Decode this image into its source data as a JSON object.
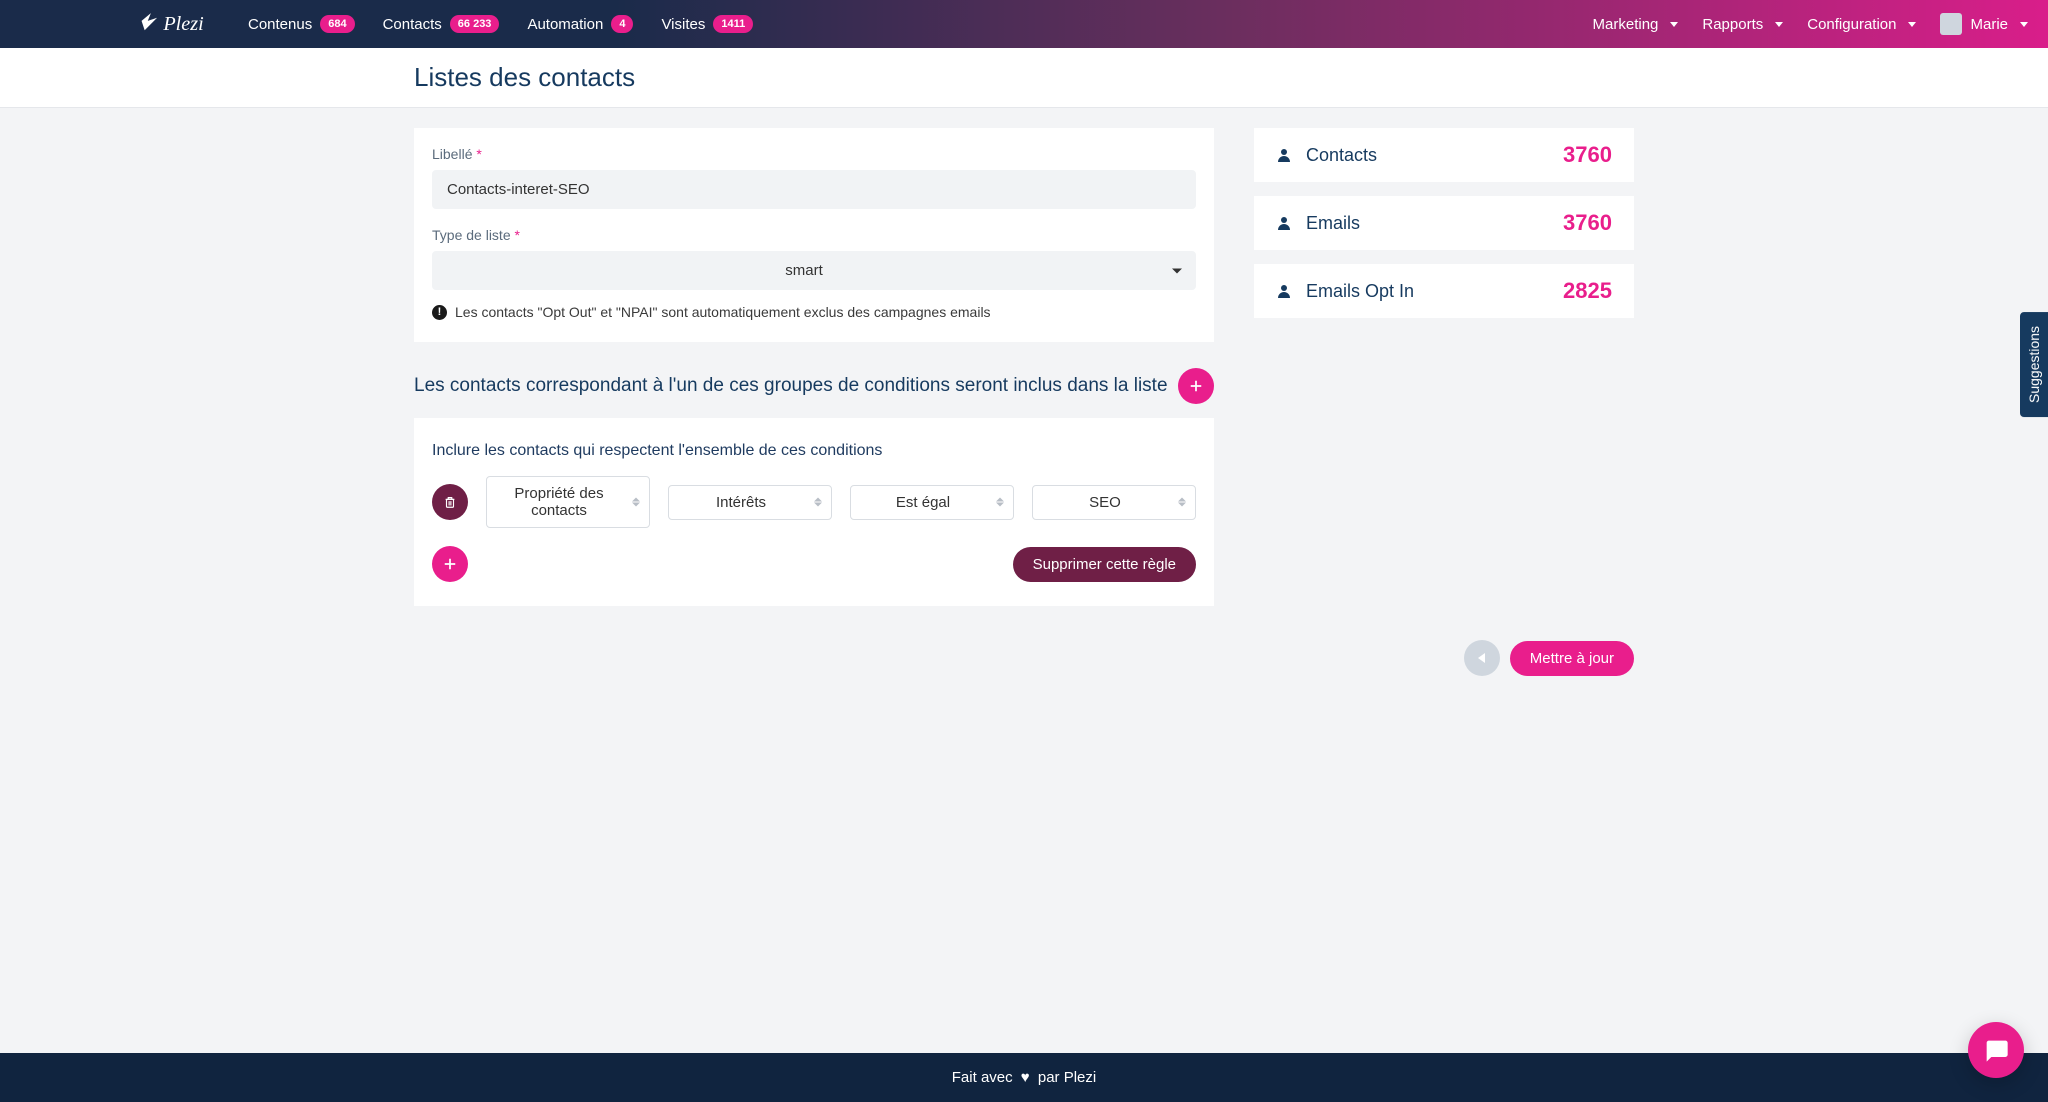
{
  "nav": {
    "brand": "Plezi",
    "left": [
      {
        "label": "Contenus",
        "badge": "684"
      },
      {
        "label": "Contacts",
        "badge": "66 233"
      },
      {
        "label": "Automation",
        "badge": "4"
      },
      {
        "label": "Visites",
        "badge": "1411"
      }
    ],
    "right": {
      "marketing": "Marketing",
      "reports": "Rapports",
      "config": "Configuration",
      "user": "Marie"
    }
  },
  "header": {
    "title": "Listes des contacts"
  },
  "form": {
    "label_libelle": "Libellé",
    "value_libelle": "Contacts-interet-SEO",
    "label_type": "Type de liste",
    "value_type": "smart",
    "info_msg": "Les contacts \"Opt Out\" et \"NPAI\" sont automatiquement exclus des campagnes emails"
  },
  "stats": {
    "contacts_label": "Contacts",
    "contacts_value": "3760",
    "emails_label": "Emails",
    "emails_value": "3760",
    "optin_label": "Emails Opt In",
    "optin_value": "2825"
  },
  "section": {
    "title": "Les contacts correspondant à l'un de ces groupes de conditions seront inclus dans la liste"
  },
  "conditions": {
    "subtitle": "Inclure les contacts qui respectent l'ensemble de ces conditions",
    "row": {
      "field": "Propriété des contacts",
      "attr": "Intérêts",
      "op": "Est égal",
      "value": "SEO"
    },
    "delete_rule": "Supprimer cette règle"
  },
  "actions": {
    "update": "Mettre à jour"
  },
  "footer": {
    "pre": "Fait avec",
    "post": "par Plezi"
  },
  "suggestions_tab": "Suggestions"
}
